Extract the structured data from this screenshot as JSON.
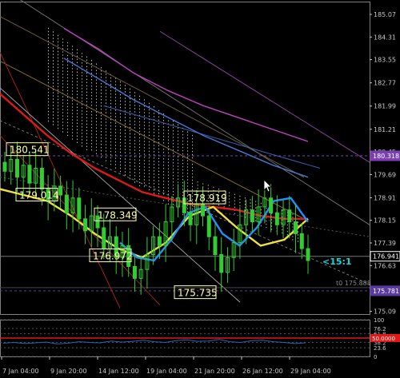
{
  "chart_data": [
    {
      "type": "candlestick",
      "title": "",
      "xlabel": "",
      "ylabel": "",
      "ylim": [
        175.0,
        185.5
      ],
      "grid": false,
      "x_ticks": [
        "7 Jan 04:00",
        "9 Jan 20:00",
        "14 Jan 12:00",
        "19 Jan 04:00",
        "21 Jan 20:00",
        "26 Jan 12:00",
        "29 Jan 04:00"
      ],
      "y_ticks": [
        185.07,
        184.31,
        183.55,
        182.77,
        181.99,
        181.21,
        180.45,
        179.69,
        178.91,
        178.15,
        177.39,
        176.63,
        175.87,
        175.09
      ],
      "price_tags": [
        {
          "label": "180.318",
          "value": 180.318,
          "color": "#7a3fb0"
        },
        {
          "label": "176.941",
          "value": 176.941,
          "color": "#ffffff"
        },
        {
          "label": "175.781",
          "value": 175.781,
          "color": "#5a3aa0"
        }
      ],
      "reference_line": {
        "label": "t0 175.888",
        "value": 175.888
      },
      "annotations": [
        {
          "text": "180.541",
          "value": 180.541
        },
        {
          "text": "179.014",
          "value": 179.014
        },
        {
          "text": "178.919",
          "value": 178.919
        },
        {
          "text": "178.349",
          "value": 178.349
        },
        {
          "text": "176.972",
          "value": 176.972
        },
        {
          "text": "175.735",
          "value": 175.735
        }
      ],
      "ratio_label": "<15:1",
      "close_series": [
        179.8,
        180.2,
        179.6,
        180.0,
        179.4,
        179.9,
        179.2,
        178.8,
        179.3,
        179.0,
        178.4,
        178.9,
        178.2,
        177.8,
        178.3,
        177.9,
        177.2,
        177.6,
        176.9,
        177.3,
        176.6,
        176.2,
        176.5,
        177.0,
        177.6,
        177.3,
        178.1,
        178.6,
        178.9,
        178.4,
        178.0,
        178.7,
        178.3,
        177.6,
        177.0,
        176.4,
        176.9,
        177.4,
        178.0,
        178.5,
        178.1,
        178.6,
        178.9,
        178.4,
        178.0,
        178.5,
        178.1,
        177.7,
        177.2,
        176.8
      ],
      "series": [
        {
          "name": "",
          "color": "#e01818",
          "values": [
            182.4,
            181.7,
            181.0,
            180.4,
            179.9,
            179.5,
            179.1,
            178.9,
            178.7,
            178.6,
            178.5,
            178.3,
            178.2,
            178.2
          ]
        },
        {
          "name": "",
          "color": "#f0e040",
          "values": [
            179.2,
            179.0,
            178.8,
            178.3,
            177.7,
            177.2,
            176.9,
            177.4,
            178.3,
            178.6,
            177.9,
            177.3,
            177.5,
            178.2
          ]
        },
        {
          "name": "",
          "color": "#1e90ff",
          "values": [
            177.4,
            176.9,
            176.8,
            177.5,
            178.4,
            178.6,
            177.7,
            177.3,
            177.9,
            178.8,
            178.9,
            178.1
          ]
        },
        {
          "name": "",
          "color": "#c040c0",
          "values": [
            184.6,
            183.9,
            183.1,
            182.5,
            182.0,
            181.6,
            181.2,
            180.8
          ]
        },
        {
          "name": "",
          "color": "#4a78d0",
          "values": [
            183.6,
            182.9,
            182.2,
            181.6,
            181.0,
            180.5,
            180.0,
            179.6
          ]
        }
      ]
    },
    {
      "type": "line",
      "title": "",
      "ylim": [
        0,
        100
      ],
      "y_ticks": [
        "100",
        "76.2",
        "61.8",
        "50.0000",
        "38.2",
        "23.6",
        "0"
      ],
      "level_line": 50,
      "series": [
        {
          "name": "",
          "color": "#3060c0",
          "values": [
            36,
            38,
            35,
            37,
            39,
            34,
            36,
            40,
            38,
            37,
            42,
            39,
            41,
            44,
            40,
            38,
            43,
            45,
            41,
            42,
            46,
            40,
            38,
            43,
            44,
            40,
            38,
            35,
            37
          ]
        }
      ]
    }
  ],
  "colors": {
    "background": "#000000",
    "axis": "#c8c8c8",
    "candle_bull": "#32cd32",
    "candle_bear": "#32cd32",
    "cloud": "#ffffff",
    "annotation_box": "#ffffaa"
  },
  "ui": {
    "cursor_icon": "mouse-pointer-icon"
  }
}
